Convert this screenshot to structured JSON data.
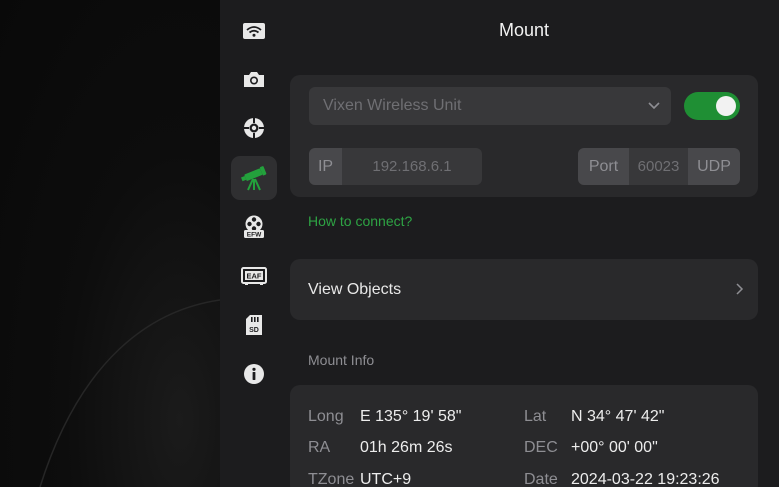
{
  "header": {
    "title": "Mount"
  },
  "sidebar": {
    "items": [
      {
        "name": "wifi",
        "icon": "wifi-icon",
        "active": false
      },
      {
        "name": "camera",
        "icon": "camera-icon",
        "active": false
      },
      {
        "name": "guide",
        "icon": "crosshair-icon",
        "active": false
      },
      {
        "name": "mount",
        "icon": "telescope-icon",
        "active": true
      },
      {
        "name": "efw",
        "icon": "filter-wheel-icon",
        "label": "EFW",
        "active": false
      },
      {
        "name": "eaf",
        "icon": "focuser-icon",
        "label": "EAF",
        "active": false
      },
      {
        "name": "sd",
        "icon": "sd-card-icon",
        "label": "SD",
        "active": false
      },
      {
        "name": "info",
        "icon": "info-icon",
        "active": false
      }
    ]
  },
  "mount_card": {
    "device_select": {
      "value": "Vixen Wireless Unit"
    },
    "enabled": true,
    "ip_label": "IP",
    "ip_value": "192.168.6.1",
    "port_label": "Port",
    "port_value": "60023",
    "protocol": "UDP"
  },
  "how_to_connect": "How to connect?",
  "view_objects": {
    "label": "View Objects"
  },
  "mount_info": {
    "section_label": "Mount Info",
    "long_label": "Long",
    "long_value": "E 135° 19' 58\"",
    "lat_label": "Lat",
    "lat_value": "N 34° 47' 42\"",
    "ra_label": "RA",
    "ra_value": "01h 26m 26s",
    "dec_label": "DEC",
    "dec_value": "+00° 00' 00\"",
    "tzone_label": "TZone",
    "tzone_value": "UTC+9",
    "date_label": "Date",
    "date_value": "2024-03-22 19:23:26"
  },
  "colors": {
    "accent_green": "#1f8f34",
    "link_green": "#2ea344",
    "panel": "#1c1c1e",
    "card": "#29292b"
  }
}
